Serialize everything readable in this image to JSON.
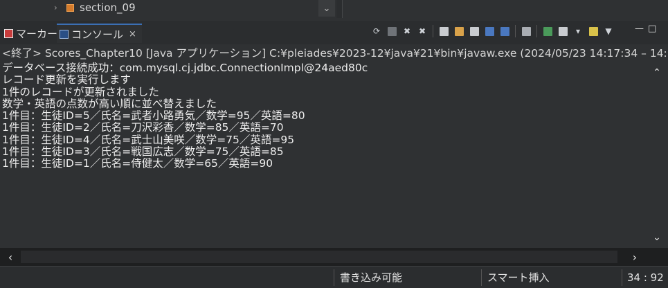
{
  "tree": {
    "item_label": "section_09"
  },
  "tabs": [
    {
      "label": "マーカー"
    },
    {
      "label": "コンソール",
      "close": "×"
    }
  ],
  "console": {
    "header": "<終了> Scores_Chapter10 [Java アプリケーション] C:¥pleiades¥2023-12¥java¥21¥bin¥javaw.exe  (2024/05/23 14:17:34 – 14:1",
    "lines": [
      "データベース接続成功：com.mysql.cj.jdbc.ConnectionImpl@24aed80c",
      "レコード更新を実行します",
      "1件のレコードが更新されました",
      "数学・英語の点数が高い順に並べ替えました",
      "1件目：生徒ID=5／氏名=武者小路勇気／数学=95／英語=80",
      "1件目：生徒ID=2／氏名=刀沢彩香／数学=85／英語=70",
      "1件目：生徒ID=4／氏名=武士山美咲／数学=75／英語=95",
      "1件目：生徒ID=3／氏名=戦国広志／数学=75／英語=85",
      "1件目：生徒ID=1／氏名=侍健太／数学=65／英語=90"
    ]
  },
  "status": {
    "writable": "書き込み可能",
    "insert_mode": "スマート挿入",
    "position": "34 : 92"
  }
}
